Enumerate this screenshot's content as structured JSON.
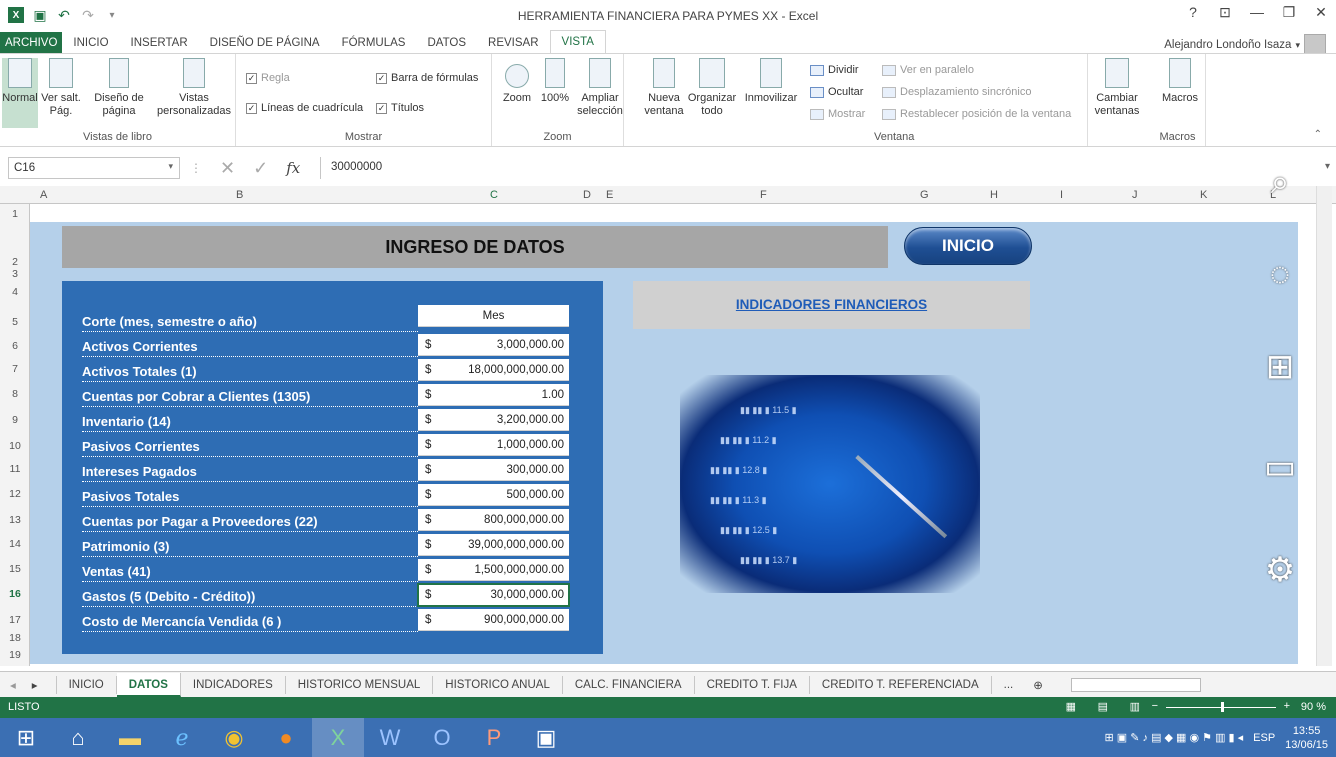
{
  "window": {
    "title": "HERRAMIENTA FINANCIERA PARA PYMES XX - Excel",
    "help": "?",
    "controls": [
      "?",
      "—",
      "❐",
      "✕"
    ]
  },
  "ribbon_tabs": [
    "ARCHIVO",
    "INICIO",
    "INSERTAR",
    "DISEÑO DE PÁGINA",
    "FÓRMULAS",
    "DATOS",
    "REVISAR",
    "VISTA"
  ],
  "active_ribbon_tab": "VISTA",
  "user": {
    "name": "Alejandro Londoño Isaza"
  },
  "ribbon": {
    "vistas_libro": {
      "label": "Vistas de libro",
      "normal": "Normal",
      "ver_salt": "Ver salt. Pág.",
      "diseno": "Diseño de página",
      "vistas": "Vistas personalizadas"
    },
    "mostrar": {
      "label": "Mostrar",
      "regla": "Regla",
      "lineas": "Líneas de cuadrícula",
      "barra": "Barra de fórmulas",
      "titulos": "Títulos"
    },
    "zoom": {
      "label": "Zoom",
      "zoom": "Zoom",
      "pct": "100%",
      "ampliar": "Ampliar selección"
    },
    "ventana": {
      "label": "Ventana",
      "nueva": "Nueva ventana",
      "organizar": "Organizar todo",
      "inmovilizar": "Inmovilizar",
      "dividir": "Dividir",
      "ocultar": "Ocultar",
      "mostrar": "Mostrar",
      "paralelo": "Ver en paralelo",
      "sincronico": "Desplazamiento sincrónico",
      "restablecer": "Restablecer posición de la ventana",
      "cambiar": "Cambiar ventanas"
    },
    "macros": {
      "label": "Macros",
      "macros": "Macros"
    }
  },
  "formula_bar": {
    "name_box": "C16",
    "value": "30000000"
  },
  "columns": [
    "A",
    "B",
    "C",
    "D",
    "E",
    "F",
    "G",
    "H",
    "I",
    "J",
    "K",
    "L"
  ],
  "rows": [
    "1",
    "2",
    "3",
    "4",
    "5",
    "6",
    "7",
    "8",
    "9",
    "10",
    "11",
    "12",
    "13",
    "14",
    "15",
    "16",
    "17",
    "18",
    "19"
  ],
  "sheet": {
    "banner": "INGRESO DE DATOS",
    "inicio_button": "INICIO",
    "indicadores": "INDICADORES FINANCIEROS",
    "period_label": "Corte (mes, semestre o año)",
    "period_value": "Mes",
    "items": [
      {
        "label": "Activos Corrientes",
        "currency": "$",
        "value": "3,000,000.00"
      },
      {
        "label": "Activos Totales  (1)",
        "currency": "$",
        "value": "18,000,000,000.00"
      },
      {
        "label": "Cuentas por Cobrar a Clientes  (1305)",
        "currency": "$",
        "value": "1.00"
      },
      {
        "label": "Inventario  (14)",
        "currency": "$",
        "value": "3,200,000.00"
      },
      {
        "label": "Pasivos Corrientes",
        "currency": "$",
        "value": "1,000,000.00"
      },
      {
        "label": "Intereses Pagados",
        "currency": "$",
        "value": "300,000.00"
      },
      {
        "label": "Pasivos Totales",
        "currency": "$",
        "value": "500,000.00"
      },
      {
        "label": "Cuentas por Pagar a Proveedores  (22)",
        "currency": "$",
        "value": "800,000,000.00"
      },
      {
        "label": "Patrimonio  (3)",
        "currency": "$",
        "value": "39,000,000,000.00"
      },
      {
        "label": "Ventas  (41)",
        "currency": "$",
        "value": "1,500,000,000.00"
      },
      {
        "label": "Gastos   (5 (Debito - Crédito))",
        "currency": "$",
        "value": "30,000,000.00"
      },
      {
        "label": "Costo de Mercancía Vendida  (6 )",
        "currency": "$",
        "value": "900,000,000.00"
      }
    ]
  },
  "sheet_tabs": [
    "INICIO",
    "DATOS",
    "INDICADORES",
    "HISTORICO MENSUAL",
    "HISTORICO ANUAL",
    "CALC. FINANCIERA",
    "CREDITO T. FIJA",
    "CREDITO T. REFERENCIADA",
    "..."
  ],
  "active_sheet": "DATOS",
  "status": {
    "ready": "LISTO",
    "zoom": "90 %"
  },
  "taskbar": {
    "lang": "ESP",
    "time": "13:55",
    "date": "13/06/15"
  },
  "colors": {
    "excel_green": "#217346",
    "panel_blue": "#2e6db4",
    "sheet_bg": "#b5d0ea",
    "link_blue": "#1f5cb8"
  }
}
